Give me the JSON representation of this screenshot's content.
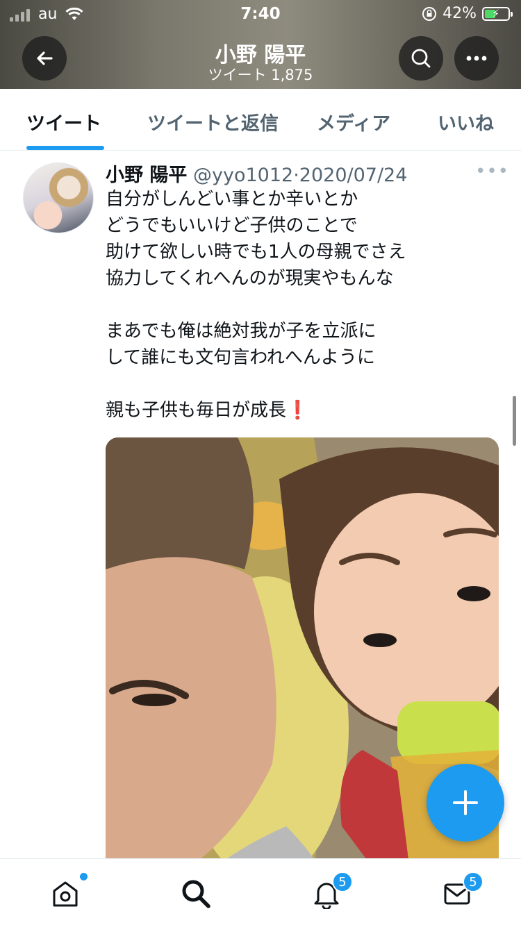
{
  "status_bar": {
    "carrier": "au",
    "time": "7:40",
    "battery": "42%"
  },
  "header": {
    "title": "小野 陽平",
    "subtitle": "ツイート 1,875"
  },
  "tabs": [
    {
      "label": "ツイート",
      "active": true
    },
    {
      "label": "ツイートと返信",
      "active": false
    },
    {
      "label": "メディア",
      "active": false
    },
    {
      "label": "いいね",
      "active": false
    }
  ],
  "tweet": {
    "author_name": "小野 陽平",
    "handle": "@yyo1012",
    "separator": "·",
    "date": "2020/07/24",
    "lines": [
      "自分がしんどい事とか辛いとか",
      "どうでもいいけど子供のことで",
      "助けて欲しい時でも1人の母親でさえ",
      "協力してくれへんのが現実やもんな",
      "まあでも俺は絶対我が子を立派に",
      "して誰にも文句言われへんように",
      "親も子供も毎日が成長❗️"
    ]
  },
  "bottom_nav": {
    "notifications_badge": "5",
    "messages_badge": "5"
  },
  "colors": {
    "accent": "#1d9bf0",
    "text_primary": "#0f1419",
    "text_secondary": "#536471"
  },
  "icons": [
    "back-arrow-icon",
    "search-icon",
    "more-icon",
    "home-icon",
    "search-icon",
    "bell-icon",
    "mail-icon",
    "plus-icon"
  ]
}
